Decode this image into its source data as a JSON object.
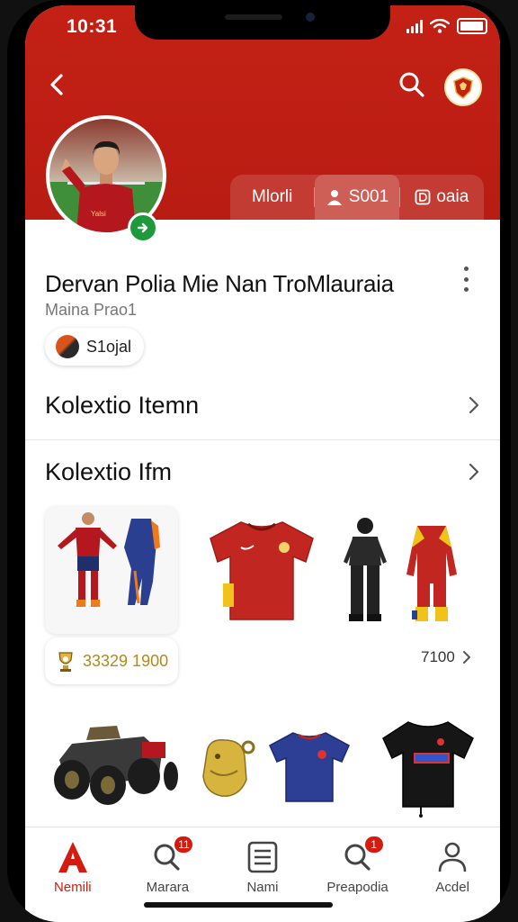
{
  "status_bar": {
    "time": "10:31"
  },
  "profile": {
    "name": "Dervan Polia Mie Nan TroMlauraia",
    "subtitle": "Maina Prao1",
    "club_label": "S1ojal"
  },
  "tabs": [
    {
      "label": "Mlorli",
      "icon": "",
      "active": false
    },
    {
      "label": "S001",
      "icon": "person-icon",
      "active": true
    },
    {
      "label": "oaia",
      "icon": "d-icon",
      "active": false
    }
  ],
  "sections": {
    "first_title": "Kolextio Itemn",
    "second_title": "Kolextio Ifm"
  },
  "collection": {
    "price": "33329 1900",
    "see_all": "7100"
  },
  "bottom_nav": [
    {
      "label": "Nemili",
      "icon": "a-logo-icon",
      "badge": "",
      "active": true
    },
    {
      "label": "Marara",
      "icon": "search-icon",
      "badge": "11",
      "active": false
    },
    {
      "label": "Nami",
      "icon": "list-icon",
      "badge": "",
      "active": false
    },
    {
      "label": "Preapodia",
      "icon": "search-icon",
      "badge": "1",
      "active": false
    },
    {
      "label": "Acdel",
      "icon": "person-icon",
      "badge": "",
      "active": false
    }
  ],
  "colors": {
    "brand_red": "#c42115",
    "verified_green": "#1e9a3a",
    "badge_red": "#d31b10"
  }
}
